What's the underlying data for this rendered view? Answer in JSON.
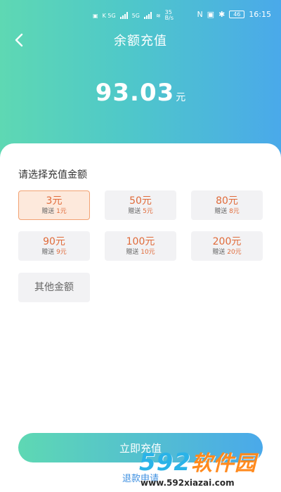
{
  "status": {
    "net1": "K 5G",
    "net2": "5G",
    "speed_value": "35",
    "speed_unit": "B/s",
    "nfc": "N",
    "battery": "46",
    "time": "16:15"
  },
  "nav": {
    "title": "余额充值"
  },
  "balance": {
    "value": "93.03",
    "unit": "元"
  },
  "recharge": {
    "section_label": "请选择充值金额",
    "bonus_prefix": "赠送",
    "options": [
      {
        "amount": "3元",
        "bonus": "1元",
        "selected": true
      },
      {
        "amount": "50元",
        "bonus": "5元",
        "selected": false
      },
      {
        "amount": "80元",
        "bonus": "8元",
        "selected": false
      },
      {
        "amount": "90元",
        "bonus": "9元",
        "selected": false
      },
      {
        "amount": "100元",
        "bonus": "10元",
        "selected": false
      },
      {
        "amount": "200元",
        "bonus": "20元",
        "selected": false
      }
    ],
    "other_label": "其他金额"
  },
  "actions": {
    "submit_label": "立即充值",
    "refund_label": "退款申请"
  },
  "watermark": {
    "logo_num": "592",
    "logo_cn": "软件园",
    "url": "www.592xiazai.com"
  },
  "colors": {
    "gradient_start": "#5ed8b3",
    "gradient_end": "#4aa9ea",
    "accent_orange": "#e06b3a",
    "selected_bg": "#fde9dc",
    "link_blue": "#3d8fe0"
  }
}
